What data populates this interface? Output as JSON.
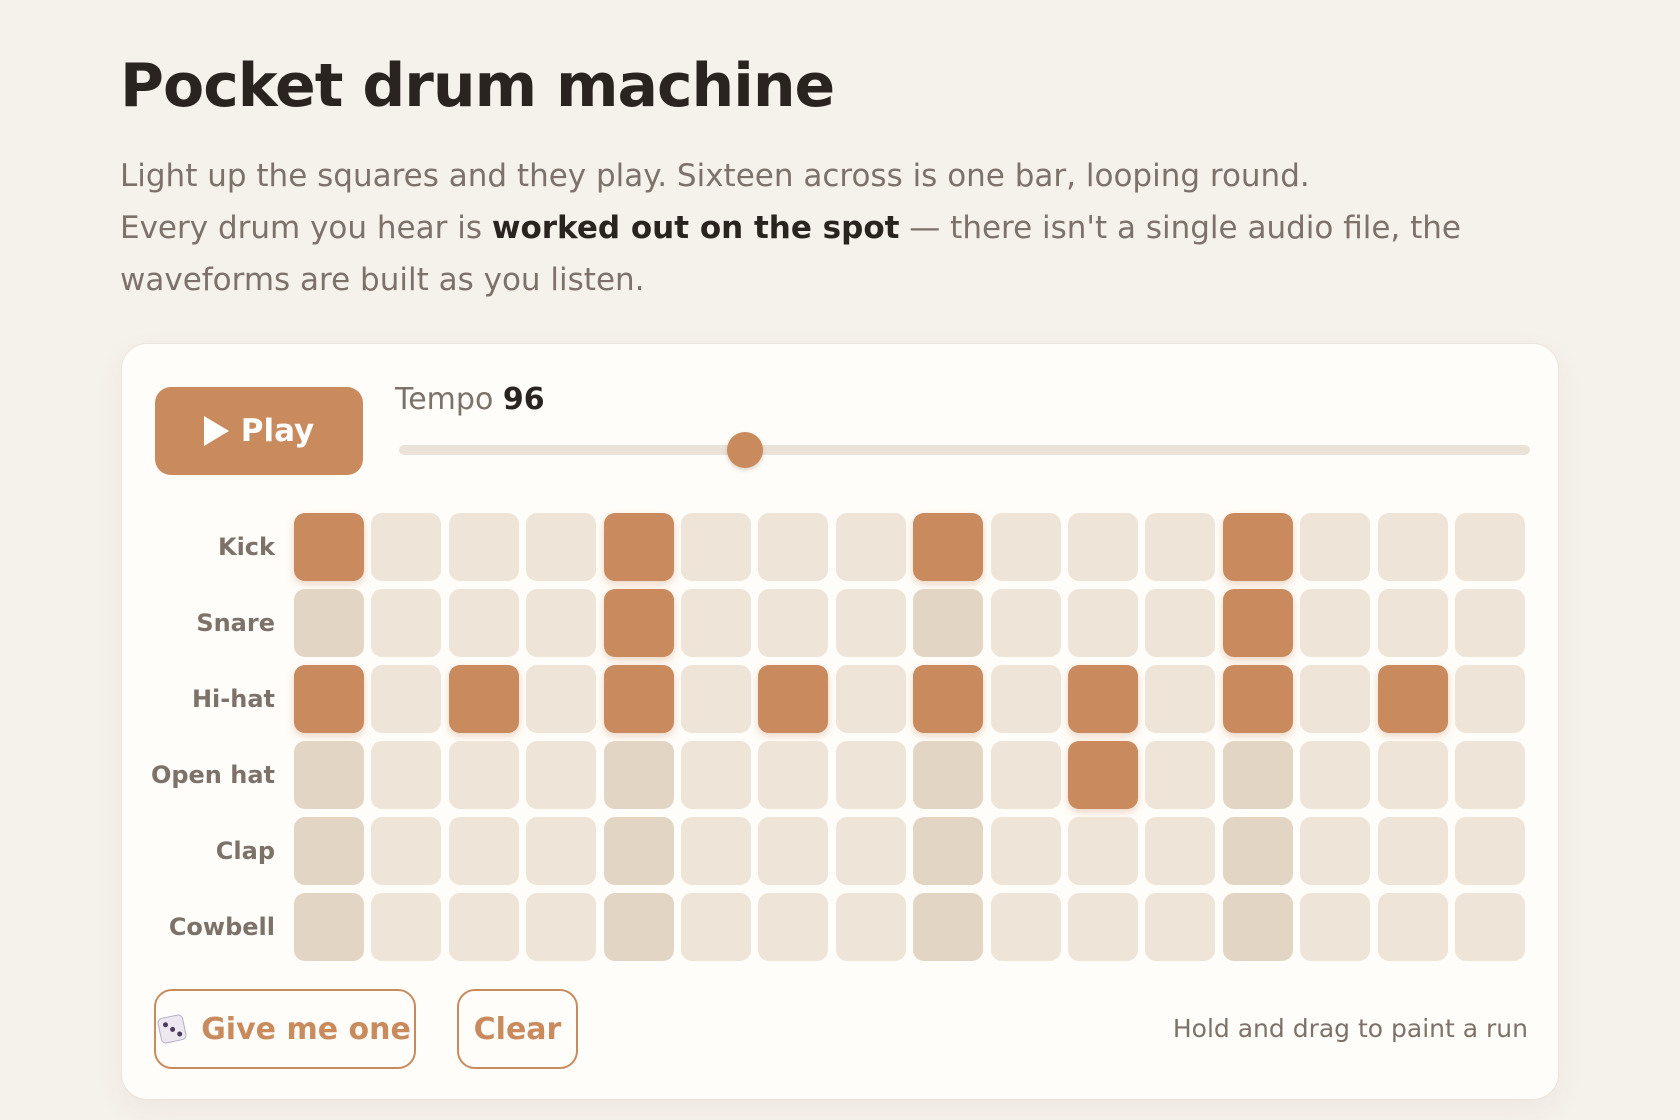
{
  "page": {
    "title": "Pocket drum machine",
    "intro_line1": "Light up the squares and they play. Sixteen across is one bar, looping round.",
    "intro_line2_pre": "Every drum you hear is ",
    "intro_line2_bold": "worked out on the spot",
    "intro_line2_post": " — there isn't a single audio file, the waveforms are built as you listen."
  },
  "controls": {
    "play_label": "Play",
    "play_icon": "play-triangle-icon",
    "tempo_label": "Tempo",
    "tempo_value": "96",
    "tempo_fraction": 0.306
  },
  "grid": {
    "steps": 16,
    "tracks": [
      {
        "name": "Kick",
        "on": [
          0,
          4,
          8,
          12
        ]
      },
      {
        "name": "Snare",
        "on": [
          4,
          12
        ]
      },
      {
        "name": "Hi-hat",
        "on": [
          0,
          2,
          4,
          6,
          8,
          10,
          12,
          14
        ]
      },
      {
        "name": "Open hat",
        "on": [
          10
        ]
      },
      {
        "name": "Clap",
        "on": []
      },
      {
        "name": "Cowbell",
        "on": []
      }
    ],
    "colors": {
      "on": "#c98a5d",
      "off": "#efe4d8",
      "beat_off": "#e2d5c4"
    }
  },
  "footer": {
    "random_label": "Give me one",
    "random_icon": "dice-icon",
    "clear_label": "Clear",
    "hint": "Hold and drag to paint a run"
  }
}
